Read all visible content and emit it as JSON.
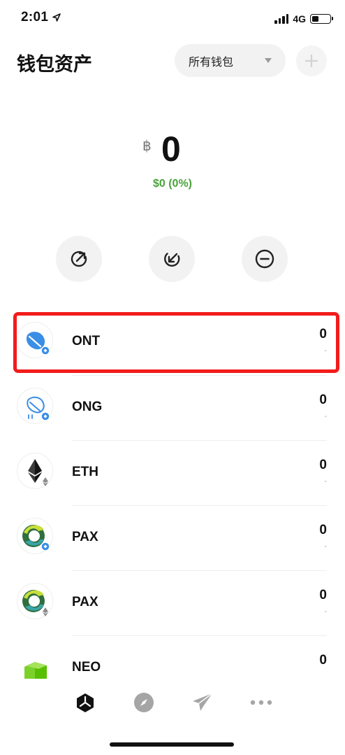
{
  "status_bar": {
    "time": "2:01",
    "network": "4G"
  },
  "header": {
    "title": "钱包资产",
    "wallet_selector": "所有钱包",
    "add_icon": "plus-icon"
  },
  "balance": {
    "currency_symbol": "฿",
    "amount": "0",
    "change": "$0 (0%)",
    "change_color": "#4aa33b"
  },
  "actions": [
    {
      "icon": "send-arrow-icon"
    },
    {
      "icon": "receive-arrow-icon"
    },
    {
      "icon": "minus-circle-icon"
    }
  ],
  "tokens": [
    {
      "symbol": "ONT",
      "amount": "0",
      "fiat": "-",
      "logo": "ont-logo",
      "highlighted": true
    },
    {
      "symbol": "ONG",
      "amount": "0",
      "fiat": "-",
      "logo": "ong-logo"
    },
    {
      "symbol": "ETH",
      "amount": "0",
      "fiat": "-",
      "logo": "eth-logo"
    },
    {
      "symbol": "PAX",
      "amount": "0",
      "fiat": "-",
      "logo": "pax-logo"
    },
    {
      "symbol": "PAX",
      "amount": "0",
      "fiat": "-",
      "logo": "pax-logo"
    },
    {
      "symbol": "NEO",
      "amount": "0",
      "fiat": "",
      "logo": "neo-logo"
    }
  ],
  "tab_bar": [
    {
      "icon": "wallet-tab-icon",
      "active": true
    },
    {
      "icon": "compass-tab-icon",
      "active": false
    },
    {
      "icon": "send-plane-tab-icon",
      "active": false
    },
    {
      "icon": "more-dots-tab-icon",
      "active": false
    }
  ],
  "colors": {
    "highlight": "#f21c1c",
    "ont_blue": "#3a8ee6",
    "neo_green": "#58bf00"
  }
}
